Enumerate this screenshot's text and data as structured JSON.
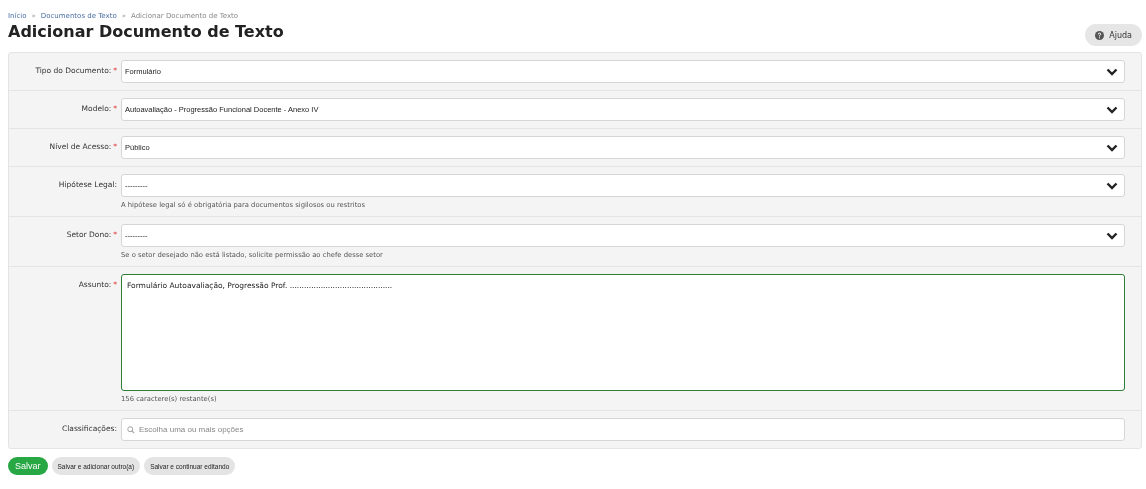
{
  "breadcrumb": [
    {
      "label": "Início"
    },
    {
      "label": "Documentos de Texto"
    },
    {
      "label": "Adicionar Documento de Texto"
    }
  ],
  "breadcrumb_separator": "»",
  "title": "Adicionar Documento de Texto",
  "help_button": {
    "label": "Ajuda"
  },
  "form": {
    "fields": [
      {
        "kind": "select",
        "label": "Tipo do Documento:",
        "required_mark": "*",
        "value": "Formulário"
      },
      {
        "kind": "select",
        "label": "Modelo:",
        "required_mark": "*",
        "value": "Autoavaliação - Progressão Funcional Docente - Anexo IV"
      },
      {
        "kind": "select",
        "label": "Nível de Acesso:",
        "required_mark": "*",
        "value": "Público"
      },
      {
        "kind": "select",
        "label": "Hipótese Legal:",
        "value": "---------",
        "help": "A hipótese legal só é obrigatória para documentos sigilosos ou restritos"
      },
      {
        "kind": "select",
        "label": "Setor Dono:",
        "required_mark": "*",
        "value": "---------",
        "help": "Se o setor desejado não está listado, solicite permissão ao chefe desse setor"
      },
      {
        "kind": "textarea",
        "label": "Assunto:",
        "required_mark": "*",
        "value": "Formulário Autoavaliação, Progressão Prof. ...........................................",
        "focused": true,
        "help": "156 caractere(s) restante(s)"
      },
      {
        "kind": "search",
        "label": "Classificações:",
        "placeholder": "Escolha uma ou mais opções"
      }
    ]
  },
  "actions": [
    {
      "label": "Salvar",
      "kind": "primary"
    },
    {
      "label": "Salvar e adicionar outro(a)",
      "kind": "secondary"
    },
    {
      "label": "Salvar e continuar editando",
      "kind": "secondary"
    }
  ]
}
